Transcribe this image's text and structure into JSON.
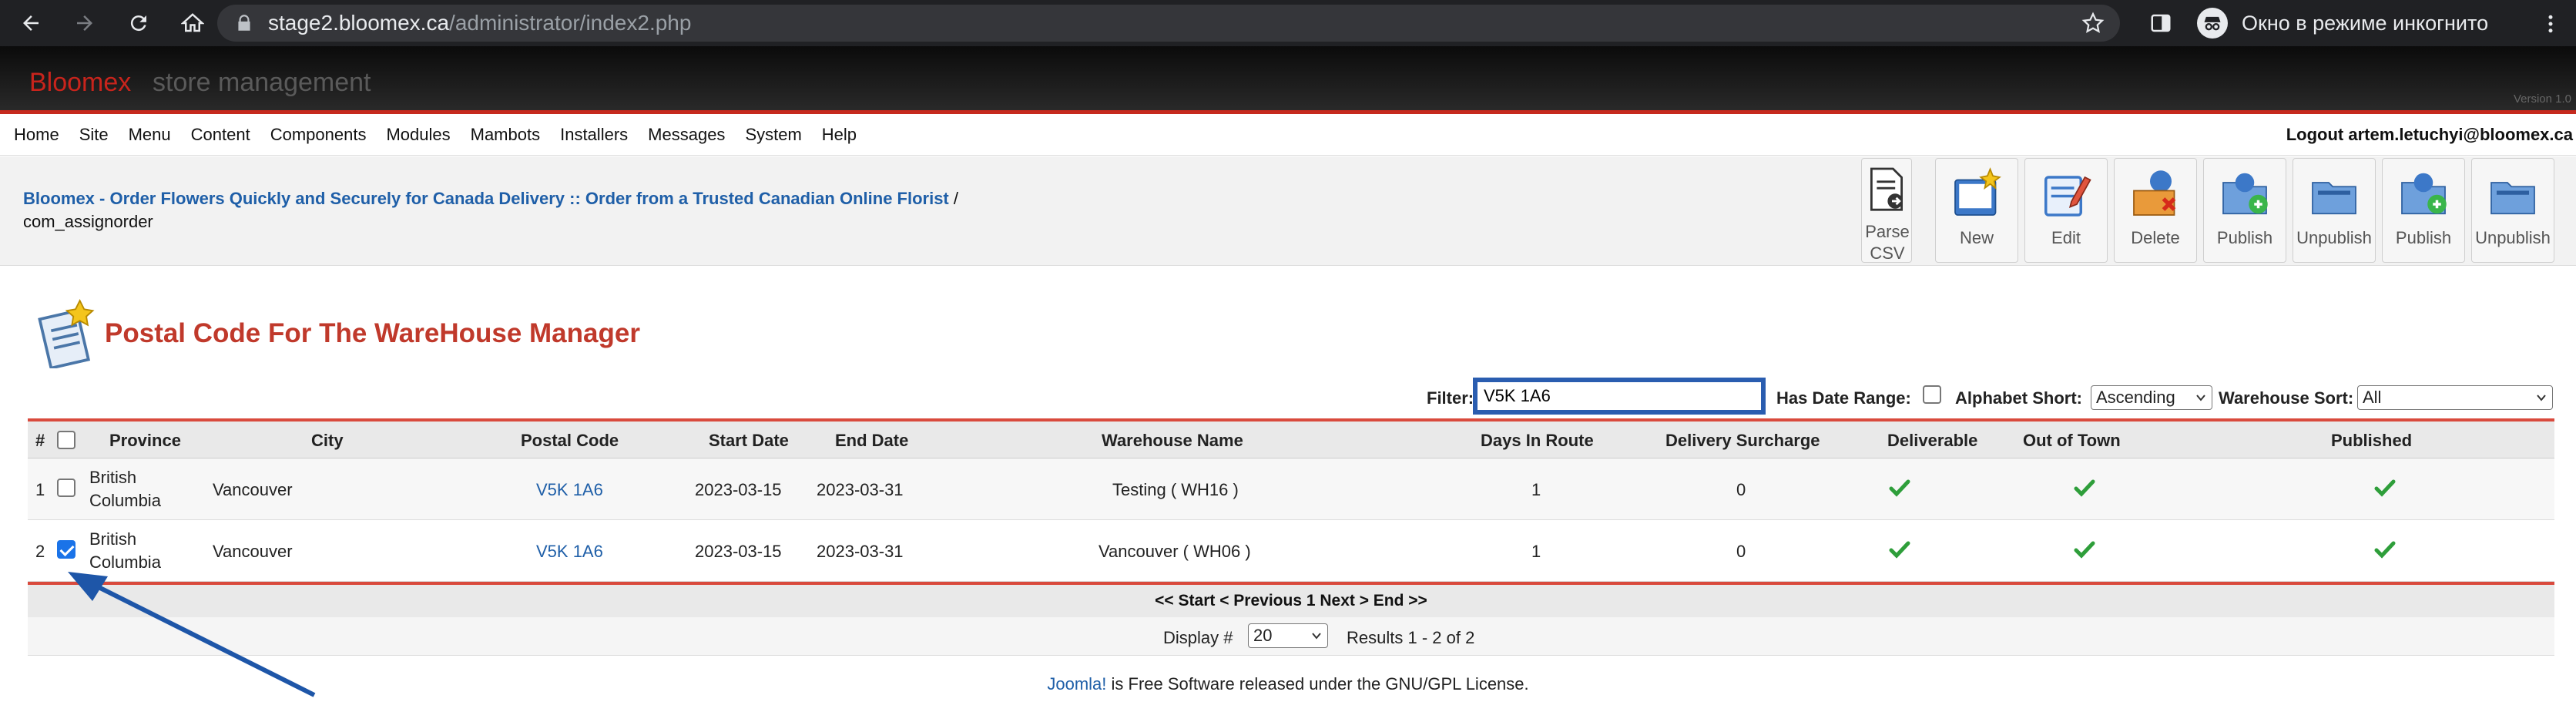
{
  "browser": {
    "url_host": "stage2.bloomex.ca",
    "url_path": "/administrator/index2.php",
    "incognito_label": "Окно в режиме инкогнито"
  },
  "header": {
    "brand": "Bloomex",
    "subtitle": "store management",
    "version": "Version 1.0"
  },
  "menu": {
    "items": [
      "Home",
      "Site",
      "Menu",
      "Content",
      "Components",
      "Modules",
      "Mambots",
      "Installers",
      "Messages",
      "System",
      "Help"
    ],
    "logout": "Logout artem.letuchyi@bloomex.ca"
  },
  "breadcrumb": {
    "link": "Bloomex - Order Flowers Quickly and Securely for Canada Delivery :: Order from a Trusted Canadian Online Florist",
    "sep": "/",
    "current": "com_assignorder"
  },
  "toolbar": {
    "buttons": [
      {
        "label": "Parse CSV",
        "icon": "parse-csv-icon"
      },
      {
        "label": "New",
        "icon": "new-icon"
      },
      {
        "label": "Edit",
        "icon": "edit-icon"
      },
      {
        "label": "Delete",
        "icon": "delete-icon"
      },
      {
        "label": "Publish",
        "icon": "publish-icon"
      },
      {
        "label": "Unpublish",
        "icon": "unpublish-icon"
      },
      {
        "label": "Publish",
        "icon": "publish-icon"
      },
      {
        "label": "Unpublish",
        "icon": "unpublish-icon"
      }
    ]
  },
  "page": {
    "title": "Postal Code For The WareHouse Manager"
  },
  "filters": {
    "filter_label": "Filter:",
    "filter_value": "V5K 1A6",
    "date_range_label": "Has Date Range:",
    "alphabet_label": "Alphabet Short:",
    "alphabet_value": "Ascending",
    "warehouse_label": "Warehouse Sort:",
    "warehouse_value": "All"
  },
  "table": {
    "headers": {
      "num": "#",
      "province": "Province",
      "city": "City",
      "postal": "Postal Code",
      "start": "Start Date",
      "end": "End Date",
      "warehouse": "Warehouse Name",
      "days": "Days In Route",
      "surcharge": "Delivery Surcharge",
      "deliverable": "Deliverable",
      "out_of_town": "Out of Town",
      "published": "Published"
    },
    "rows": [
      {
        "num": "1",
        "province_l1": "British",
        "province_l2": "Columbia",
        "city": "Vancouver",
        "postal": "V5K 1A6",
        "start": "2023-03-15",
        "end": "2023-03-31",
        "warehouse": "Testing ( WH16 )",
        "days": "1",
        "surcharge": "0",
        "checked": false
      },
      {
        "num": "2",
        "province_l1": "British",
        "province_l2": "Columbia",
        "city": "Vancouver",
        "postal": "V5K 1A6",
        "start": "2023-03-15",
        "end": "2023-03-31",
        "warehouse": "Vancouver ( WH06 )",
        "days": "1",
        "surcharge": "0",
        "checked": true
      }
    ],
    "pager": "<< Start < Previous 1 Next > End >>",
    "display_label": "Display #",
    "display_value": "20",
    "results": "Results 1 - 2 of 2"
  },
  "footer": {
    "link": "Joomla!",
    "text": " is Free Software released under the GNU/GPL License."
  },
  "colors": {
    "accent_red": "#c0392b",
    "link_blue": "#1f5fa8",
    "highlight_blue": "#2a5db0",
    "check_green": "#2e9e3a"
  }
}
